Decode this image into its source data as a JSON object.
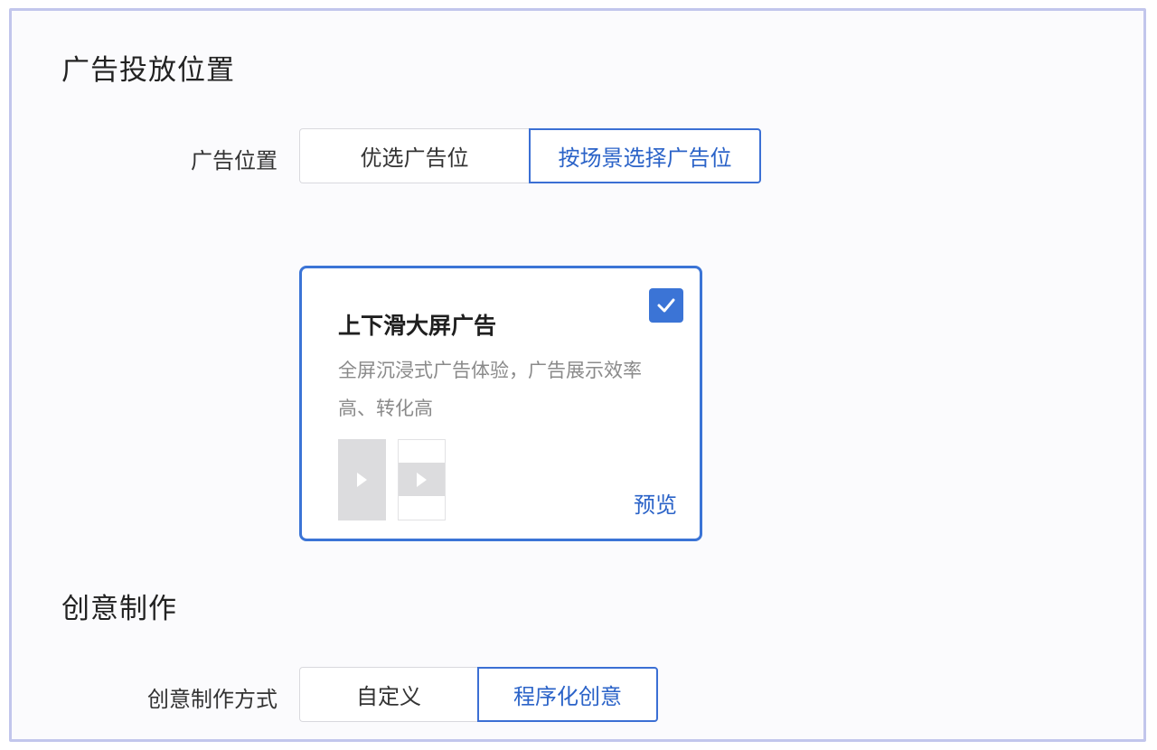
{
  "placement": {
    "title": "广告投放位置",
    "position_label": "广告位置",
    "options": [
      "优选广告位",
      "按场景选择广告位"
    ],
    "selected_index": 1
  },
  "card": {
    "title": "上下滑大屏广告",
    "description": "全屏沉浸式广告体验，广告展示效率高、转化高",
    "checked": true,
    "preview_label": "预览",
    "check_icon": "checkmark-icon",
    "preview_icons": [
      "play-icon",
      "play-icon"
    ]
  },
  "creative": {
    "title": "创意制作",
    "method_label": "创意制作方式",
    "options": [
      "自定义",
      "程序化创意"
    ],
    "selected_index": 1
  },
  "colors": {
    "accent": "#3b74d6",
    "frame_border": "#c2c6ec"
  }
}
